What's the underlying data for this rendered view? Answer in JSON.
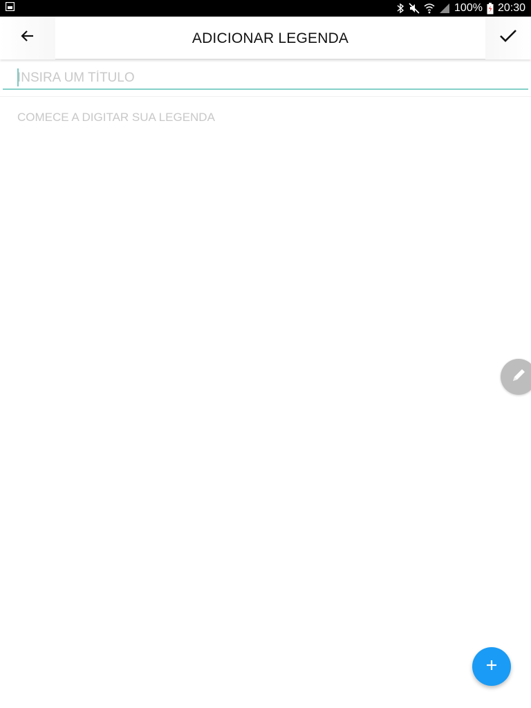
{
  "status_bar": {
    "battery_percent": "100%",
    "time": "20:30",
    "icons": [
      "gallery-notification-icon",
      "bluetooth-icon",
      "mute-icon",
      "wifi-icon",
      "signal-icon",
      "battery-icon"
    ]
  },
  "app_bar": {
    "title": "ADICIONAR LEGENDA",
    "back_icon": "arrow-left-icon",
    "confirm_icon": "check-icon"
  },
  "form": {
    "title_placeholder": "INSIRA UM TÍTULO",
    "title_value": "",
    "caption_placeholder": "COMECE A DIGITAR SUA LEGENDA",
    "caption_value": ""
  },
  "floating": {
    "edit_icon": "pencil-icon",
    "add_icon": "plus-icon"
  },
  "colors": {
    "accent": "#1a9bf5",
    "input_underline": "#86cfc9",
    "status_bar": "#000000",
    "placeholder": "#c9c9c9"
  }
}
